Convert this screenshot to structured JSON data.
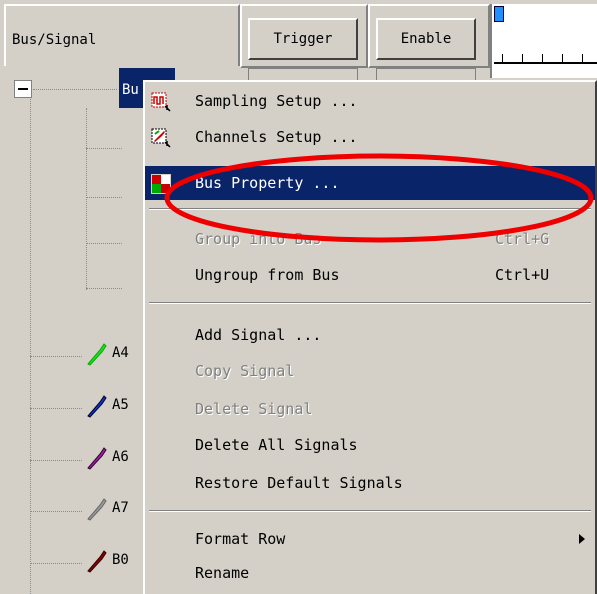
{
  "header": {
    "bus_signal_label": "Bus/Signal",
    "trigger_label": "Trigger",
    "enable_label": "Enable"
  },
  "tree": {
    "bus_label": "Bu",
    "signals": [
      {
        "label": "A4",
        "color": "#22dd22"
      },
      {
        "label": "A5",
        "color": "#1133cc"
      },
      {
        "label": "A6",
        "color": "#992299"
      },
      {
        "label": "A7",
        "color": "#999999"
      },
      {
        "label": "B0",
        "color": "#880000"
      }
    ]
  },
  "menu": {
    "items": [
      {
        "label": "Sampling Setup ...",
        "icon": "sampling-setup-icon",
        "enabled": true
      },
      {
        "label": "Channels Setup ...",
        "icon": "channels-setup-icon",
        "enabled": true
      },
      {
        "label": "Bus Property ...",
        "icon": "bus-property-icon",
        "enabled": true,
        "selected": true
      },
      {
        "label": "Group into Bus",
        "shortcut": "Ctrl+G",
        "enabled": false
      },
      {
        "label": "Ungroup from Bus",
        "shortcut": "Ctrl+U",
        "enabled": true
      },
      {
        "label": "Add Signal ...",
        "enabled": true
      },
      {
        "label": "Copy Signal",
        "enabled": false
      },
      {
        "label": "Delete Signal",
        "enabled": false
      },
      {
        "label": "Delete All Signals",
        "enabled": true
      },
      {
        "label": "Restore Default Signals",
        "enabled": true
      },
      {
        "label": "Format Row",
        "enabled": true,
        "has_submenu": true
      },
      {
        "label": "Rename",
        "enabled": true
      }
    ]
  },
  "colors": {
    "selection": "#0a246a",
    "annotation": "#ee0000"
  }
}
